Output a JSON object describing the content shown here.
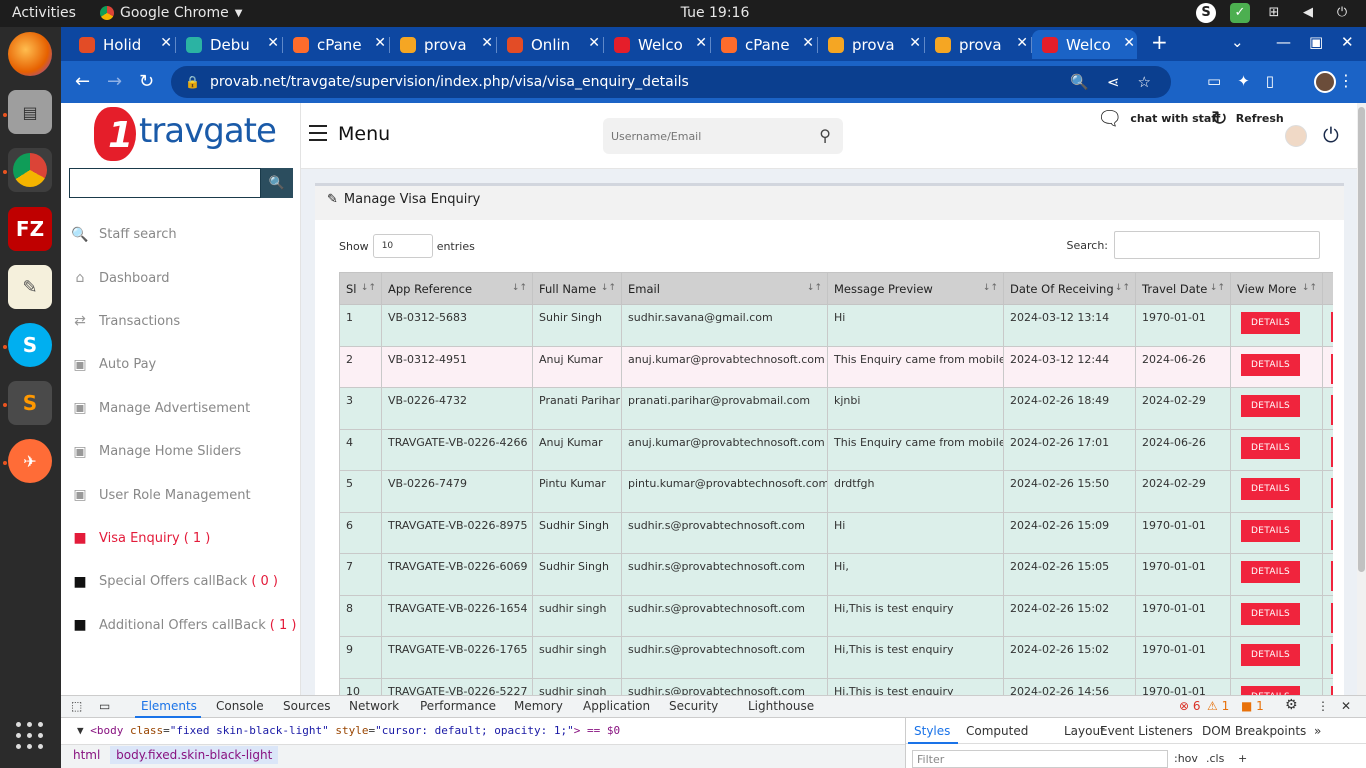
{
  "os": {
    "activities": "Activities",
    "app_name": "Google Chrome",
    "clock": "Tue 19:16"
  },
  "browser": {
    "tabs": [
      {
        "label": "Holid",
        "color": "#e34c26"
      },
      {
        "label": "Debu",
        "color": "#2bb3a3"
      },
      {
        "label": "cPane",
        "color": "#ff6c2c"
      },
      {
        "label": "prova",
        "color": "#f5a623"
      },
      {
        "label": "Onlin",
        "color": "#e34c26"
      },
      {
        "label": "Welco",
        "color": "#e51e2a"
      },
      {
        "label": "cPane",
        "color": "#ff6c2c"
      },
      {
        "label": "prova",
        "color": "#f5a623"
      },
      {
        "label": "prova",
        "color": "#f5a623"
      },
      {
        "label": "Welco",
        "color": "#e51e2a"
      }
    ],
    "url": "provab.net/travgate/supervision/index.php/visa/visa_enquiry_details"
  },
  "sidebar": {
    "logo_text": "travgate",
    "search_value": "",
    "items": [
      {
        "label": "Staff search",
        "icon": "search-icon",
        "glyph": "🔍"
      },
      {
        "label": "Dashboard",
        "icon": "home-icon",
        "glyph": "⌂"
      },
      {
        "label": "Transactions",
        "icon": "exchange-icon",
        "glyph": "⇄"
      },
      {
        "label": "Auto Pay",
        "icon": "money-icon",
        "glyph": "▣"
      },
      {
        "label": "Manage Advertisement",
        "icon": "money-icon",
        "glyph": "▣"
      },
      {
        "label": "Manage Home Sliders",
        "icon": "money-icon",
        "glyph": "▣"
      },
      {
        "label": "User Role Management",
        "icon": "money-icon",
        "glyph": "▣"
      },
      {
        "label": "Visa Enquiry",
        "count": "( 1 )",
        "icon": "visa-icon",
        "glyph": "■",
        "active": true
      },
      {
        "label": "Special Offers callBack",
        "count": "( 0 )",
        "icon": "offer-icon",
        "glyph": "■"
      },
      {
        "label": "Additional Offers callBack",
        "count": "( 1 )",
        "icon": "offer-icon",
        "glyph": "■"
      }
    ]
  },
  "header": {
    "menu_label": "Menu",
    "search_placeholder": "Username/Email",
    "chat_label": "chat with staff",
    "refresh_label": "Refresh"
  },
  "box": {
    "title": "Manage Visa Enquiry",
    "show_label": "Show",
    "show_value": "10",
    "entries_label": "entries",
    "search_label": "Search:"
  },
  "table": {
    "columns": [
      "Sl",
      "App Reference",
      "Full Name",
      "Email",
      "Message Preview",
      "Date Of Receiving",
      "Travel Date",
      "View More"
    ],
    "details_label": "DETAILS",
    "rows": [
      [
        "1",
        "VB-0312-5683",
        "Suhir Singh",
        "sudhir.savana@gmail.com",
        "Hi",
        "2024-03-12 13:14",
        "1970-01-01"
      ],
      [
        "2",
        "VB-0312-4951",
        "Anuj Kumar",
        "anuj.kumar@provabtechnosoft.com",
        "This Enquiry came from mobile.",
        "2024-03-12 12:44",
        "2024-06-26"
      ],
      [
        "3",
        "VB-0226-4732",
        "Pranati Parihar",
        "pranati.parihar@provabmail.com",
        "kjnbi",
        "2024-02-26 18:49",
        "2024-02-29"
      ],
      [
        "4",
        "TRAVGATE-VB-0226-4266",
        "Anuj Kumar",
        "anuj.kumar@provabtechnosoft.com",
        "This Enquiry came from mobile.",
        "2024-02-26 17:01",
        "2024-06-26"
      ],
      [
        "5",
        "VB-0226-7479",
        "Pintu Kumar",
        "pintu.kumar@provabtechnosoft.com",
        "drdtfgh",
        "2024-02-26 15:50",
        "2024-02-29"
      ],
      [
        "6",
        "TRAVGATE-VB-0226-8975",
        "Sudhir Singh",
        "sudhir.s@provabtechnosoft.com",
        "Hi",
        "2024-02-26 15:09",
        "1970-01-01"
      ],
      [
        "7",
        "TRAVGATE-VB-0226-6069",
        "Sudhir Singh",
        "sudhir.s@provabtechnosoft.com",
        "Hi,",
        "2024-02-26 15:05",
        "1970-01-01"
      ],
      [
        "8",
        "TRAVGATE-VB-0226-1654",
        "sudhir singh",
        "sudhir.s@provabtechnosoft.com",
        "Hi,This is test enquiry",
        "2024-02-26 15:02",
        "1970-01-01"
      ],
      [
        "9",
        "TRAVGATE-VB-0226-1765",
        "sudhir singh",
        "sudhir.s@provabtechnosoft.com",
        "Hi,This is test enquiry",
        "2024-02-26 15:02",
        "1970-01-01"
      ],
      [
        "10",
        "TRAVGATE-VB-0226-5227",
        "sudhir singh",
        "sudhir.s@provabtechnosoft.com",
        "Hi,This is test enquiry",
        "2024-02-26 14:56",
        "1970-01-01"
      ]
    ]
  },
  "devtools": {
    "tabs": [
      "Elements",
      "Console",
      "Sources",
      "Network",
      "Performance",
      "Memory",
      "Application",
      "Security",
      "Lighthouse"
    ],
    "errors": "6",
    "warnings": "1",
    "info": "1",
    "code_prefix": "▼",
    "code_tag": "<body",
    "code_attr1": "class",
    "code_val1": "\"fixed skin-black-light\"",
    "code_attr2": "style",
    "code_val2": "\"cursor: default; opacity: 1;\"",
    "code_suffix": "> == $0",
    "crumbs": [
      "html",
      "body.fixed.skin-black-light"
    ],
    "side_tabs": [
      "Styles",
      "Computed",
      "Layout",
      "Event Listeners",
      "DOM Breakpoints"
    ],
    "filter_placeholder": "Filter",
    "hov": ":hov",
    "cls": ".cls"
  },
  "colors": {
    "accent_red": "#f0243d",
    "chrome_blue": "#1b63c6",
    "row_odd": "#dcefea",
    "row_even": "#fcf0f5"
  }
}
